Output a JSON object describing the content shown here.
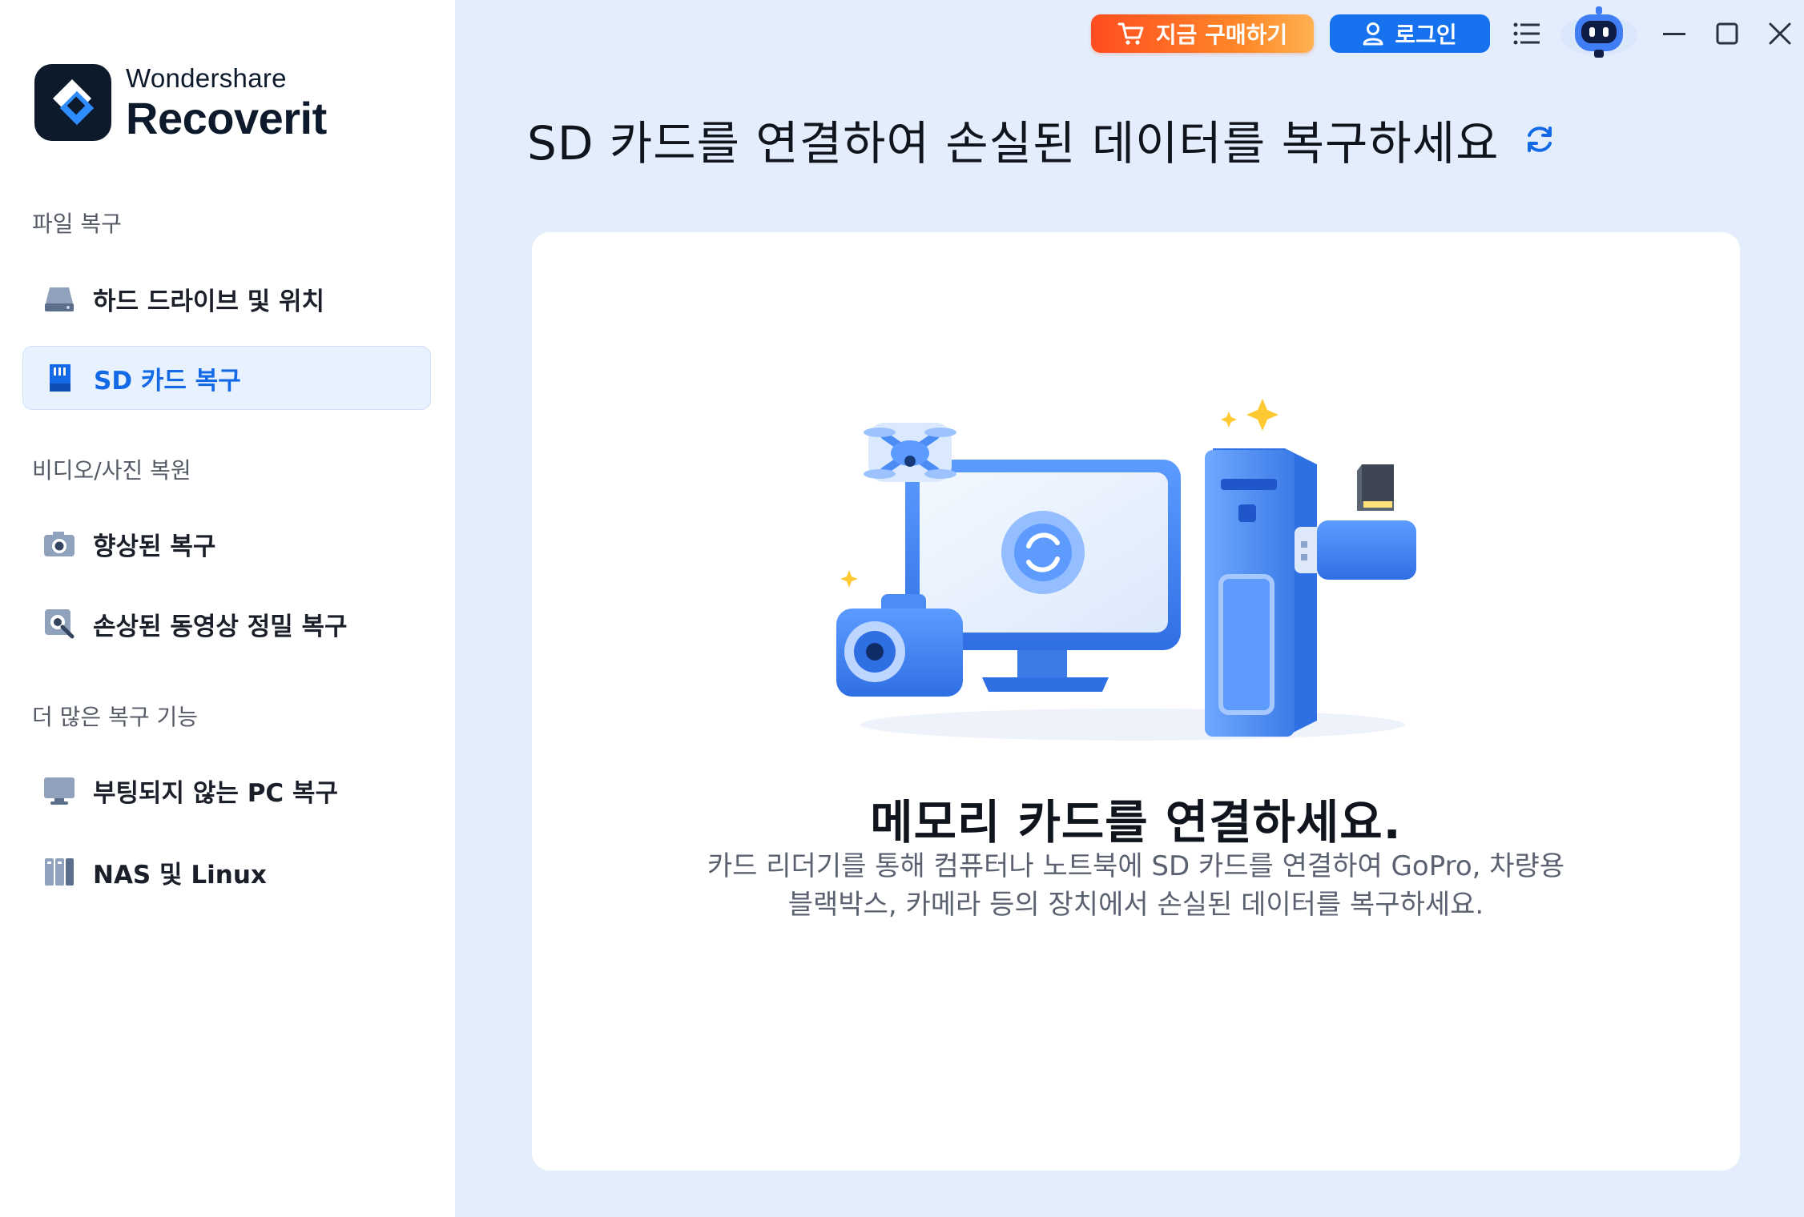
{
  "app": {
    "brand": "Wondershare",
    "product": "Recoverit"
  },
  "topbar": {
    "buy_label": "지금 구매하기",
    "login_label": "로그인",
    "icons": [
      "cart-icon",
      "user-icon",
      "menu-icon",
      "assistant-robot-icon",
      "minimize-icon",
      "maximize-icon",
      "close-icon"
    ]
  },
  "sidebar": {
    "sections": [
      {
        "title": "파일 복구"
      },
      {
        "title": "비디오/사진 복원"
      },
      {
        "title": "더 많은 복구 기능"
      }
    ],
    "items": [
      {
        "label": "하드 드라이브 및 위치",
        "icon": "hard-drive-icon"
      },
      {
        "label": "SD 카드 복구",
        "icon": "sd-card-icon",
        "active": true
      },
      {
        "label": "향상된 복구",
        "icon": "camera-icon"
      },
      {
        "label": "손상된 동영상 정밀 복구",
        "icon": "video-repair-icon"
      },
      {
        "label": "부팅되지 않는 PC 복구",
        "icon": "monitor-icon"
      },
      {
        "label": "NAS 및 Linux",
        "icon": "nas-icon"
      }
    ]
  },
  "main": {
    "headline": "SD 카드를 연결하여 손실된 데이터를 복구하세요",
    "card": {
      "title": "메모리 카드를 연결하세요.",
      "description_line1": "카드 리더기를 통해 컴퓨터나 노트북에 SD 카드를 연결하여 GoPro, 차량용",
      "description_line2": "블랙박스, 카메라 등의 장치에서 손실된 데이터를 복구하세요."
    }
  },
  "colors": {
    "accent": "#1369e6",
    "login_button": "#1672ef",
    "buy_gradient_start": "#ff4d1f",
    "buy_gradient_end": "#ffb152",
    "main_background": "#e3edfb",
    "card_background": "#ffffff"
  }
}
